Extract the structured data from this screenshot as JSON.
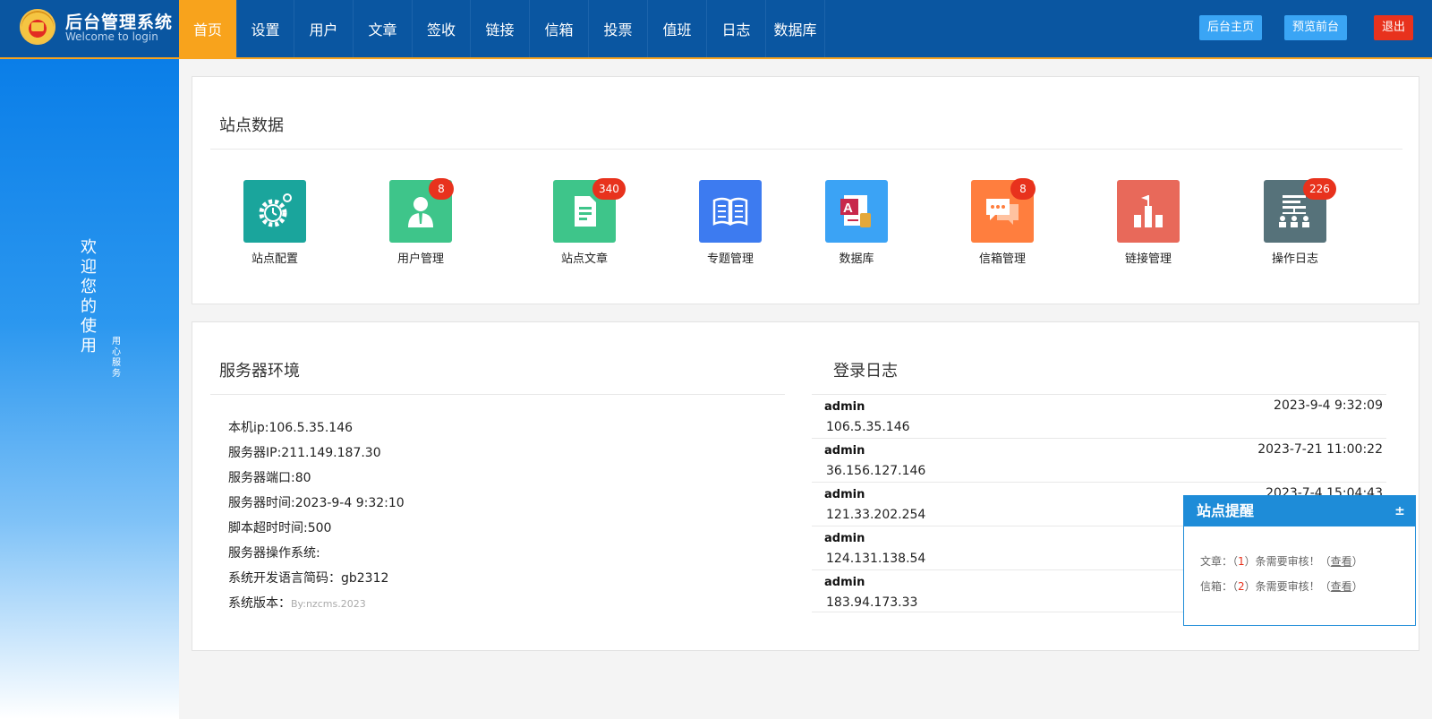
{
  "brand": {
    "title": "后台管理系统",
    "subtitle": "Welcome to login"
  },
  "nav": [
    {
      "label": "首页",
      "active": true
    },
    {
      "label": "设置"
    },
    {
      "label": "用户"
    },
    {
      "label": "文章"
    },
    {
      "label": "签收"
    },
    {
      "label": "链接"
    },
    {
      "label": "信箱"
    },
    {
      "label": "投票"
    },
    {
      "label": "值班"
    },
    {
      "label": "日志"
    },
    {
      "label": "数据库"
    }
  ],
  "header_buttons": {
    "admin_home": "后台主页",
    "preview": "预览前台",
    "logout": "退出"
  },
  "sidebar": {
    "welcome": "欢迎您的使用",
    "service": "用心服务"
  },
  "site_data": {
    "title": "站点数据",
    "items": [
      {
        "label": "站点配置",
        "badge": "",
        "color": "#1aa59c",
        "icon": "gear-clock-icon"
      },
      {
        "label": "用户管理",
        "badge": "8",
        "color": "#3ec58a",
        "icon": "user-icon"
      },
      {
        "label": "站点文章",
        "badge": "340",
        "color": "#3ec58a",
        "icon": "document-icon"
      },
      {
        "label": "专题管理",
        "badge": "",
        "color": "#3d7bf0",
        "icon": "book-icon"
      },
      {
        "label": "数据库",
        "badge": "",
        "color": "#3ba3f5",
        "icon": "access-database-icon"
      },
      {
        "label": "信箱管理",
        "badge": "8",
        "color": "#ff7e3e",
        "icon": "chat-icon"
      },
      {
        "label": "链接管理",
        "badge": "",
        "color": "#e8695a",
        "icon": "bar-flag-icon"
      },
      {
        "label": "操作日志",
        "badge": "226",
        "color": "#56727a",
        "icon": "sitemap-icon"
      }
    ]
  },
  "server_env": {
    "title": "服务器环境",
    "lines": [
      "本机ip:106.5.35.146",
      "服务器IP:211.149.187.30",
      "服务器端口:80",
      "服务器时间:2023-9-4 9:32:10",
      "脚本超时时间:500",
      "服务器操作系统:",
      "系统开发语言简码：gb2312"
    ],
    "version_label": "系统版本：",
    "version_value": "By:nzcms.2023"
  },
  "login_log": {
    "title": "登录日志",
    "rows": [
      {
        "user": "admin",
        "time": "2023-9-4 9:32:09",
        "ip": "106.5.35.146"
      },
      {
        "user": "admin",
        "time": "2023-7-21 11:00:22",
        "ip": "36.156.127.146"
      },
      {
        "user": "admin",
        "time": "2023-7-4 15:04:43",
        "ip": "121.33.202.254"
      },
      {
        "user": "admin",
        "time": "",
        "ip": "124.131.138.54"
      },
      {
        "user": "admin",
        "time": "",
        "ip": "183.94.173.33"
      }
    ]
  },
  "reminder": {
    "title": "站点提醒",
    "toggle": "±",
    "article": {
      "prefix": "文章：（",
      "count": "1",
      "suffix": "）条需要审核！（",
      "link": "查看",
      "end": "）"
    },
    "mailbox": {
      "prefix": "信箱：（",
      "count": "2",
      "suffix": "）条需要审核！（",
      "link": "查看",
      "end": "）"
    }
  }
}
